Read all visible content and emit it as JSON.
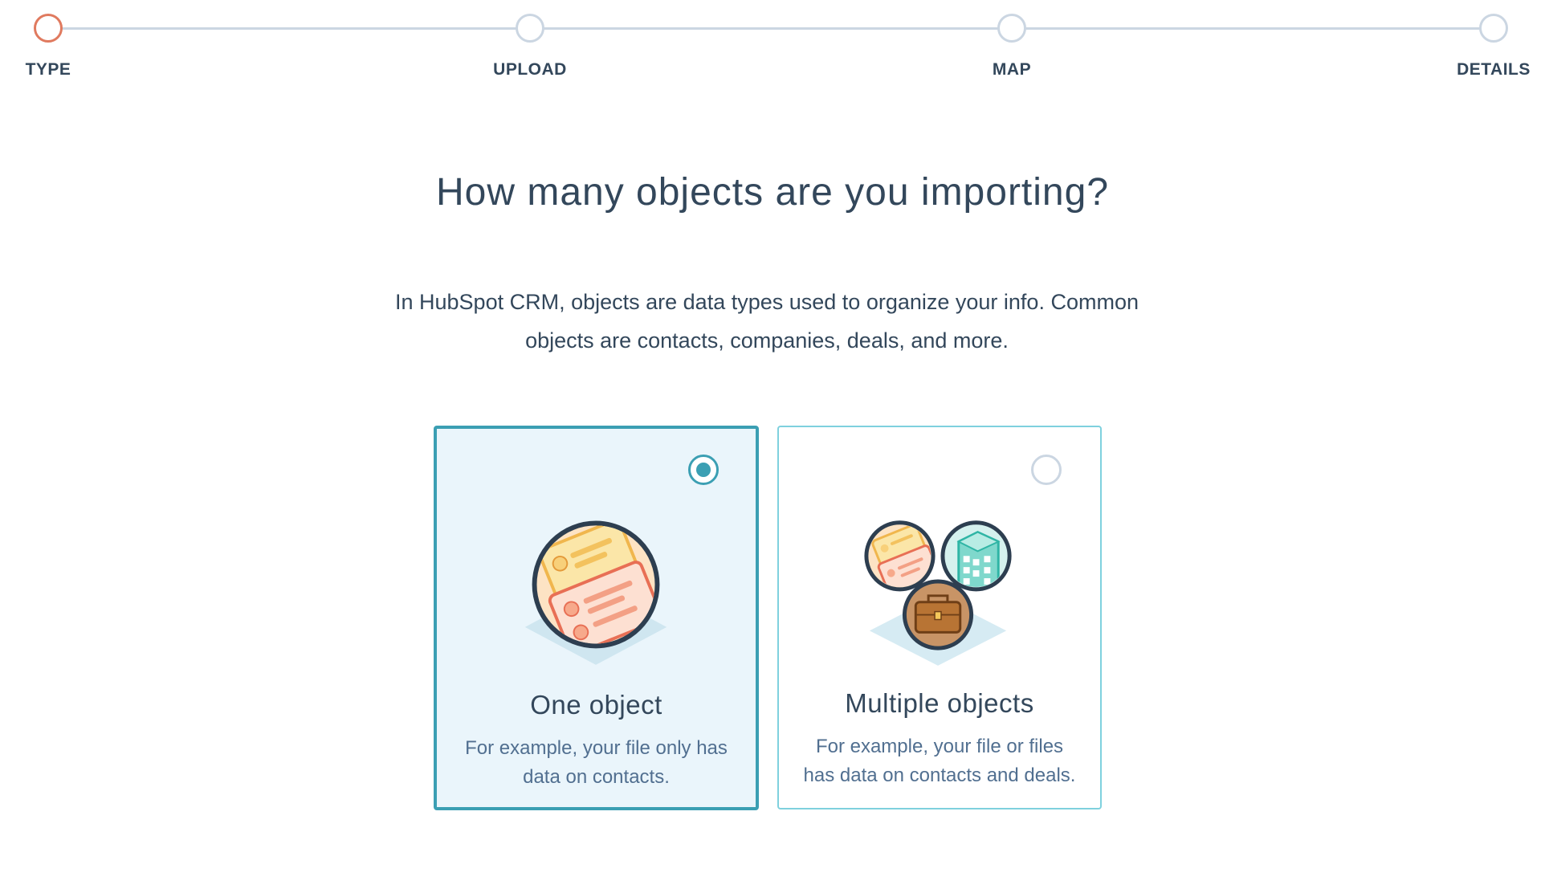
{
  "stepper": {
    "steps": [
      {
        "label": "TYPE",
        "state": "active"
      },
      {
        "label": "UPLOAD",
        "state": "upcoming"
      },
      {
        "label": "MAP",
        "state": "upcoming"
      },
      {
        "label": "DETAILS",
        "state": "upcoming"
      }
    ]
  },
  "main": {
    "title": "How many objects are you importing?",
    "intro_line1": "In HubSpot CRM, objects are data types used to organize your info. Common",
    "intro_line2": "objects are contacts, companies, deals, and more."
  },
  "options": [
    {
      "title": "One object",
      "desc_line1": "For example, your file only has",
      "desc_line2": "data on contacts.",
      "selected": true,
      "icon": "contacts-stack-icon"
    },
    {
      "title": "Multiple objects",
      "desc_line1": "For example, your file or files",
      "desc_line2": "has data on contacts and deals.",
      "selected": false,
      "icon": "multiple-objects-icon"
    }
  ],
  "colors": {
    "active_step": "#e07a5f",
    "inactive_step": "#cbd6e2",
    "selected_border": "#3b9fb3",
    "selected_bg": "#eaf5fb",
    "text": "#33475b"
  }
}
